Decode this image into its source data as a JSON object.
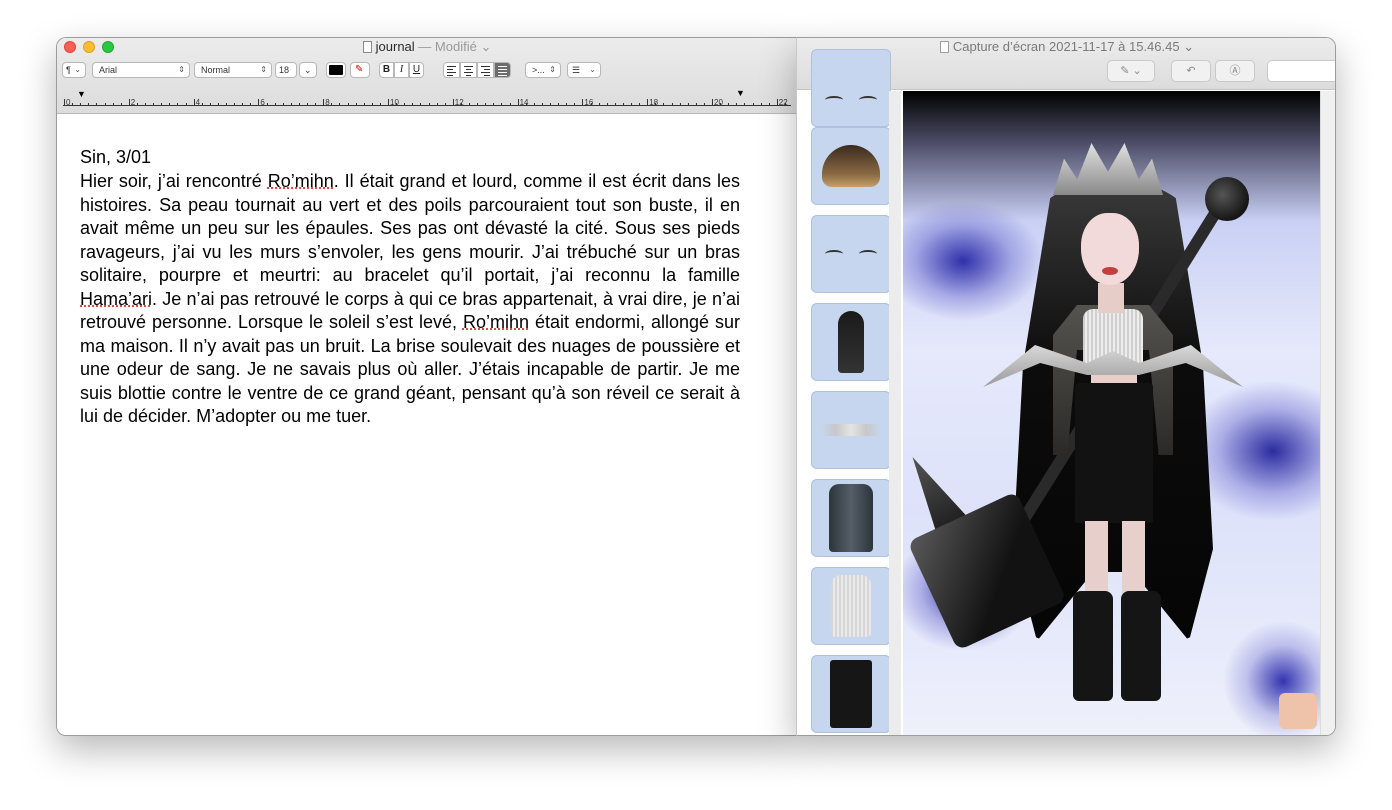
{
  "textedit": {
    "title": "journal",
    "title_separator": " — ",
    "modified": "Modifié",
    "toolbar": {
      "paragraph_style": "¶",
      "font_family": "Arial",
      "typeface": "Normal",
      "font_size": "18",
      "spacing": ">...",
      "list": "☰"
    },
    "ruler_labels": [
      "0",
      "2",
      "4",
      "6",
      "8",
      "10",
      "12",
      "14",
      "16",
      "18",
      "20",
      "22"
    ],
    "document": {
      "heading": "Sin, 3/01",
      "body_parts": [
        "Hier soir, j’ai rencontré ",
        "Ro’mihn",
        ". Il était grand et lourd, comme il est écrit dans les histoires. Sa peau tournait au vert et des poils parcouraient tout son buste, il en avait même un peu sur les épaules. Ses pas ont dévasté la cité. Sous ses pieds ravageurs, j’ai vu les murs s’envoler, les gens mourir. J’ai trébuché sur un bras solitaire, pourpre et meurtri: au bracelet qu’il portait, j’ai reconnu la famille ",
        "Hama’ari",
        ". Je n’ai pas retrouvé le corps à qui ce bras appartenait, à vrai dire, je n’ai retrouvé personne. Lorsque le soleil s’est levé, ",
        "Ro’mihn",
        " était endormi, allongé sur ma maison. Il n’y avait pas un bruit. La brise soulevait des nuages de poussière et une odeur de sang. Je ne savais plus où aller. J’étais incapable de partir. Je me suis blottie contre le ventre de ce grand géant, pensant qu’à son réveil ce serait à lui de décider. M’adopter ou me tuer."
      ]
    }
  },
  "preview": {
    "title": "Capture d’écran 2021-11-17 à 15.46.45",
    "thumbnails": [
      "eyebrows",
      "hair-top",
      "eyes",
      "hair-long",
      "horns",
      "jacket",
      "tank-top",
      "pants"
    ]
  },
  "colors": {
    "close": "#fe5f57",
    "minimize": "#febc2e",
    "maximize": "#28c840",
    "thumb_bg": "#c5d6ee",
    "misspelled_underline": "#e03030"
  }
}
